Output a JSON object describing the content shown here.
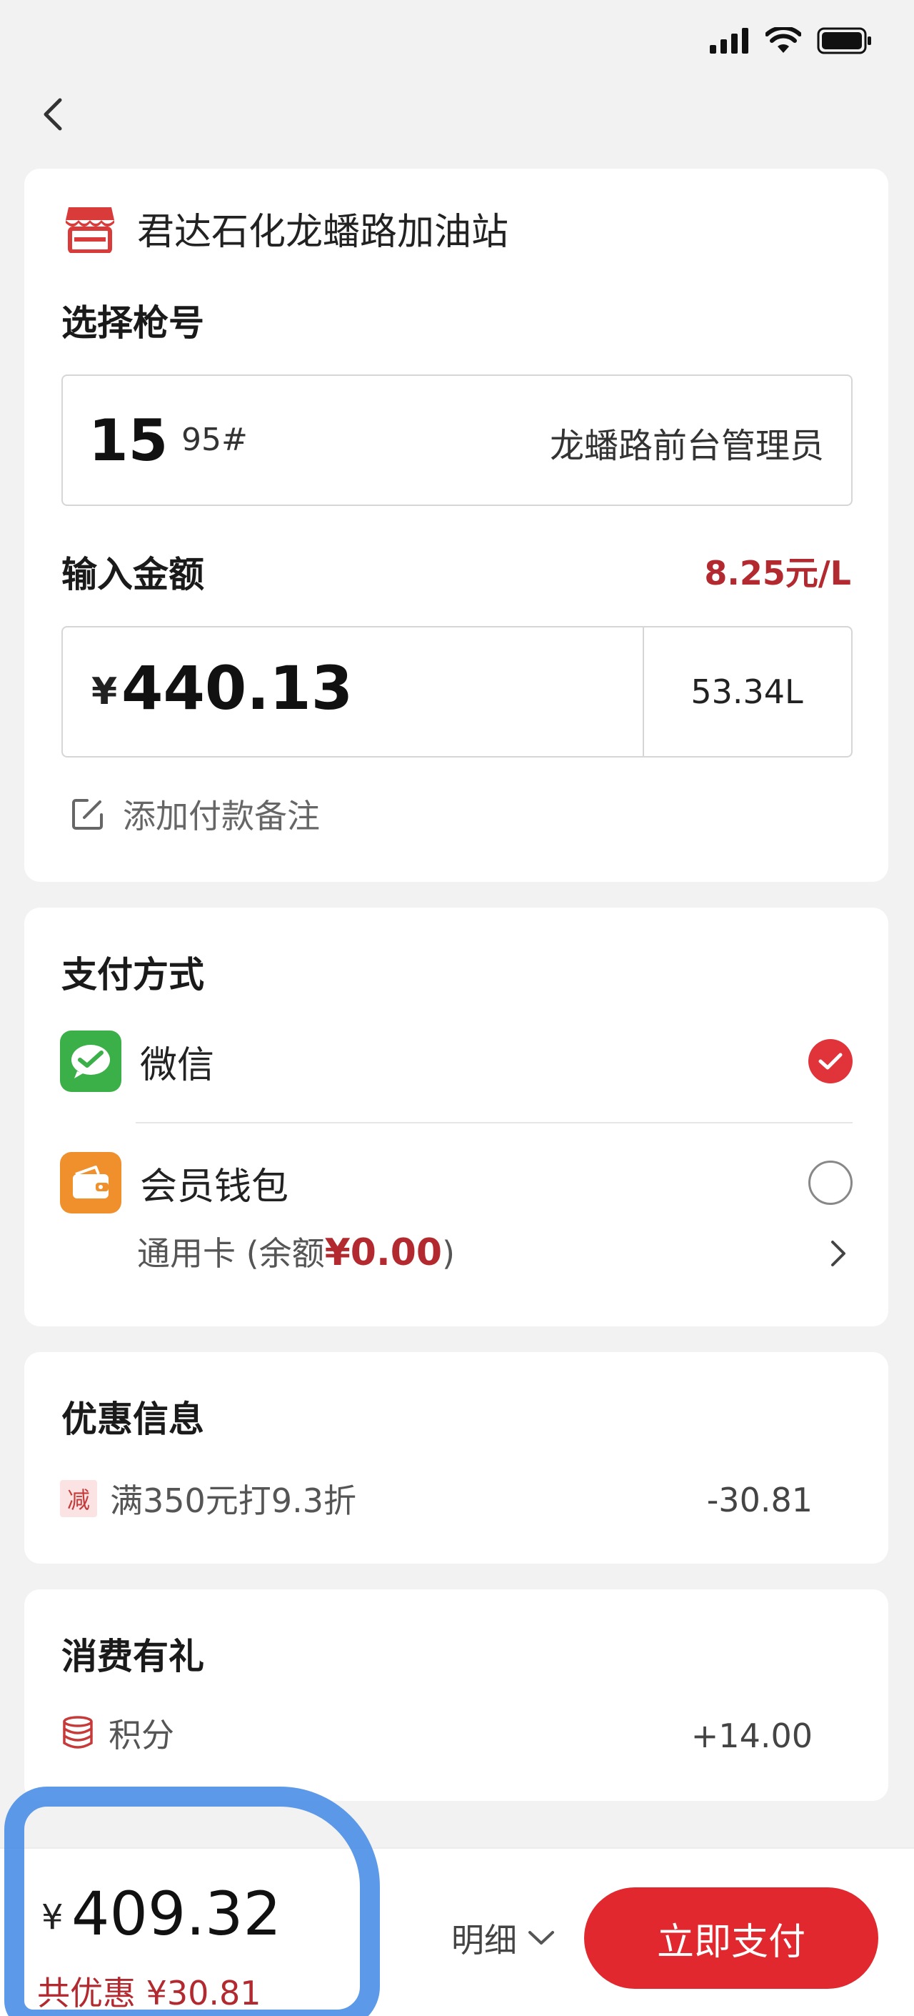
{
  "station": {
    "name": "君达石化龙蟠路加油站"
  },
  "gun_section": {
    "title": "选择枪号",
    "gun_number": "15",
    "grade": "95#",
    "operator": "龙蟠路前台管理员"
  },
  "amount_section": {
    "title": "输入金额",
    "price_unit": "8.25元/L",
    "currency": "¥",
    "amount": "440.13",
    "liters": "53.34L",
    "note_label": "添加付款备注"
  },
  "payment_section": {
    "title": "支付方式",
    "methods": [
      {
        "label": "微信",
        "selected": true
      },
      {
        "label": "会员钱包",
        "selected": false
      }
    ],
    "wallet_balance_prefix": "通用卡 (余额 ",
    "wallet_balance_amount": "¥0.00",
    "wallet_balance_suffix": ")"
  },
  "promotion_section": {
    "title": "优惠信息",
    "badge": "减",
    "text": "满350元打9.3折",
    "value": "-30.81"
  },
  "reward_section": {
    "title": "消费有礼",
    "label": "积分",
    "value": "+14.00"
  },
  "bottom_bar": {
    "currency": "¥",
    "total": "409.32",
    "saving": "共优惠 ¥30.81",
    "detail_label": "明细",
    "pay_label": "立即支付"
  },
  "colors": {
    "accent_red": "#e0282e",
    "price_red": "#b22a30",
    "wechat_green": "#3bb049",
    "wallet_orange": "#f0902c",
    "annotation_blue": "#4a8fe7"
  }
}
